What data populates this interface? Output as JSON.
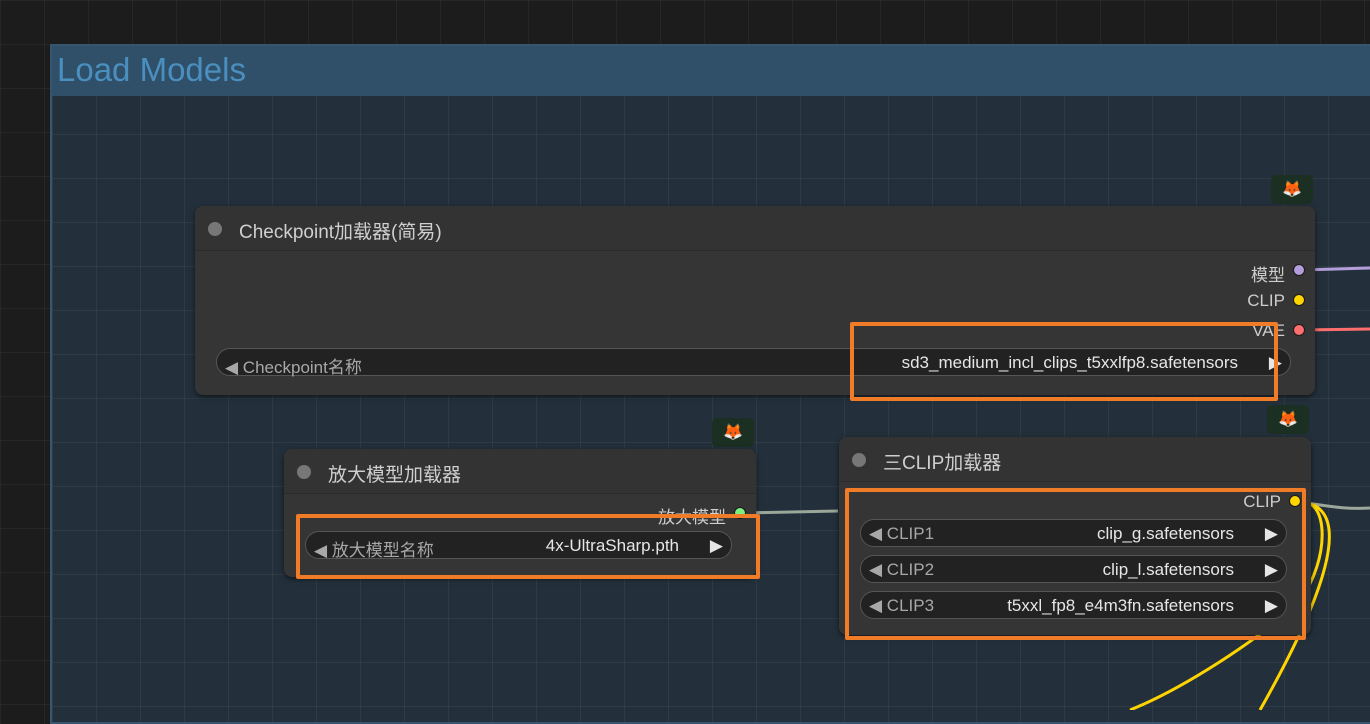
{
  "group": {
    "title": "Load Models"
  },
  "checkpoint_node": {
    "badge_icon": "fox-icon",
    "title": "Checkpoint加载器(简易)",
    "outputs": [
      {
        "label": "模型",
        "color": "#b39ddb"
      },
      {
        "label": "CLIP",
        "color": "#ffd500"
      },
      {
        "label": "VAE",
        "color": "#ff6e6e"
      }
    ],
    "widget": {
      "label": "Checkpoint名称",
      "value": "sd3_medium_incl_clips_t5xxlfp8.safetensors"
    }
  },
  "upscale_node": {
    "badge_icon": "fox-icon",
    "title": "放大模型加载器",
    "output": {
      "label": "放大模型",
      "color": "#7cf07c"
    },
    "widget": {
      "label": "放大模型名称",
      "value": "4x-UltraSharp.pth"
    }
  },
  "triple_clip_node": {
    "badge_icon": "fox-icon",
    "title": "三CLIP加载器",
    "output": {
      "label": "CLIP",
      "color": "#ffd500"
    },
    "widgets": [
      {
        "label": "CLIP1",
        "value": "clip_g.safetensors"
      },
      {
        "label": "CLIP2",
        "value": "clip_l.safetensors"
      },
      {
        "label": "CLIP3",
        "value": "t5xxl_fp8_e4m3fn.safetensors"
      }
    ]
  },
  "highlight_color": "#f07c28"
}
